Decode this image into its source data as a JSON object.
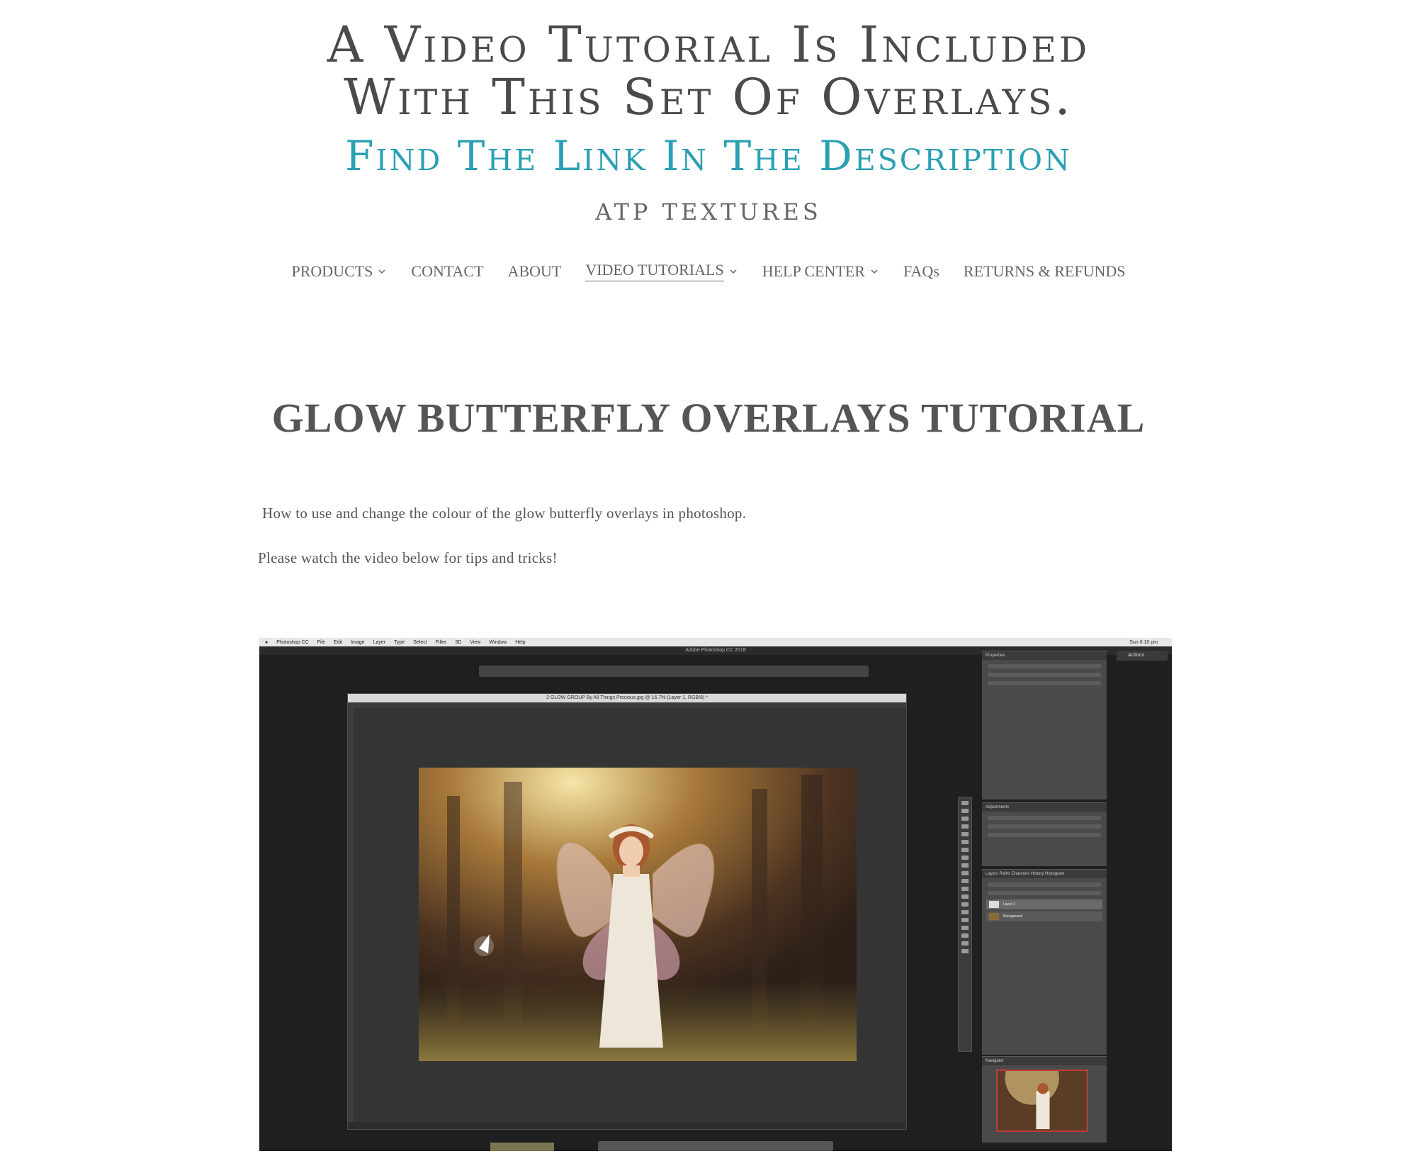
{
  "banner": {
    "line1": "A Video Tutorial Is Included",
    "line2": "With This Set Of Overlays.",
    "link_line": "Find The Link In The Description"
  },
  "brand": "ATP TEXTURES",
  "nav": {
    "items": [
      {
        "label": "PRODUCTS",
        "dropdown": true
      },
      {
        "label": "CONTACT",
        "dropdown": false
      },
      {
        "label": "ABOUT",
        "dropdown": false
      },
      {
        "label": "VIDEO TUTORIALS",
        "dropdown": true,
        "active": true
      },
      {
        "label": "HELP CENTER",
        "dropdown": true
      },
      {
        "label": "FAQs",
        "dropdown": false
      },
      {
        "label": "RETURNS & REFUNDS",
        "dropdown": false
      }
    ]
  },
  "page": {
    "title": "GLOW BUTTERFLY OVERLAYS TUTORIAL",
    "intro": "How to use and change the colour of the glow butterfly overlays in photoshop.",
    "note": "Please watch the video below for tips and tricks!"
  },
  "video": {
    "menubar": [
      "Photoshop CC",
      "File",
      "Edit",
      "Image",
      "Layer",
      "Type",
      "Select",
      "Filter",
      "3D",
      "View",
      "Window",
      "Help"
    ],
    "clock": "Sun 6:10 pm",
    "app_title": "Adobe Photoshop CC 2018",
    "doc_title": "2 GLOW GROUP By All Things Precious.jpg @ 16.7% (Layer 1, RGB/8) *",
    "panels": {
      "properties": "Properties",
      "adjustments": "Adjustments",
      "layers_tabs": "Layers  Paths  Channels  History  Histogram",
      "navigator": "Navigator"
    },
    "layers": [
      "Layer 1",
      "Background"
    ],
    "actions_label": "Actions"
  },
  "colors": {
    "banner_text": "#4a4a4a",
    "accent": "#2aa0b3",
    "body_text": "#555555"
  }
}
